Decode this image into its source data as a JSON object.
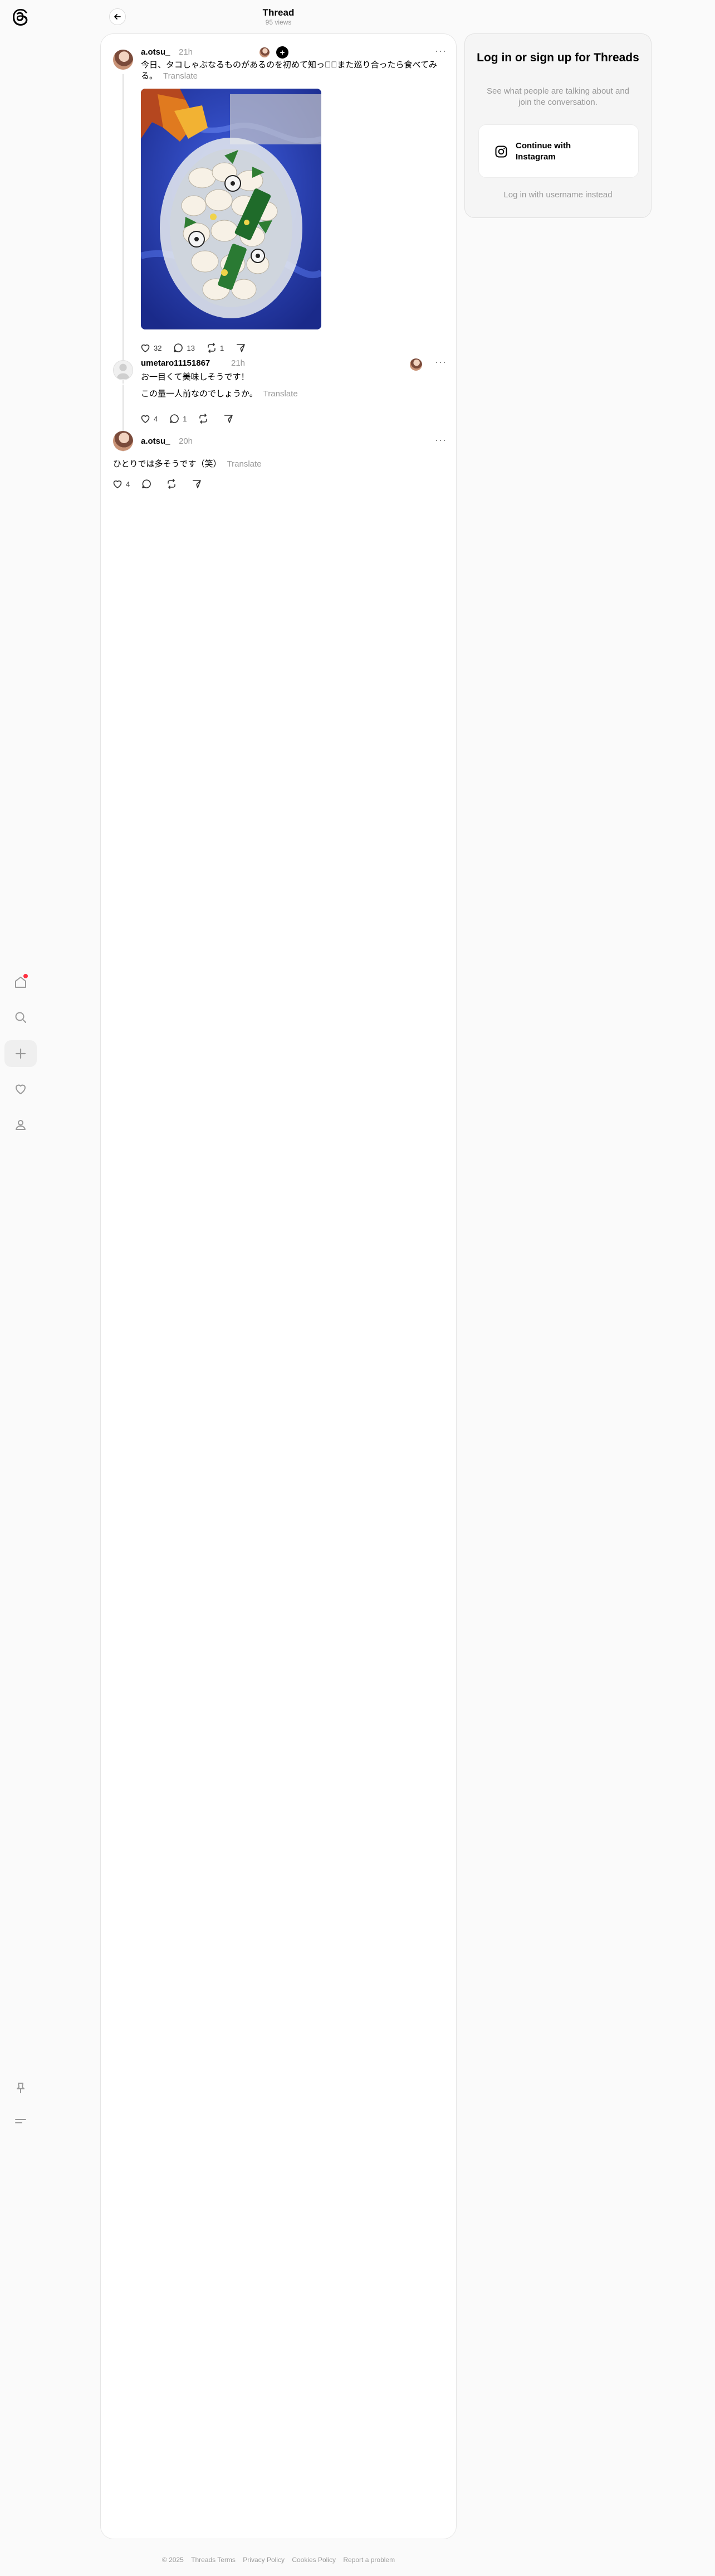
{
  "header": {
    "title": "Thread",
    "subtitle": "95 views"
  },
  "posts": [
    {
      "username": "a.otsu_",
      "time": "21h",
      "text": "今日、タコしゃぶなるものがあるのを初めて知った⃣また巡り合ったら食べてみる。",
      "translate": "Translate",
      "likes": "32",
      "replies": "13",
      "reposts": "1"
    },
    {
      "username": "umetaro11151867",
      "time": "21h",
      "line1": "お一目くて美味しそうです！",
      "line2": "この量一人前なのでしょうか。",
      "translate": "Translate",
      "likes": "4",
      "replies": "1"
    },
    {
      "username": "a.otsu_",
      "time": "20h",
      "text": "ひとりでは多そうです（笑）",
      "translate": "Translate",
      "likes": "4"
    }
  ],
  "login": {
    "title": "Log in or sign up for Threads",
    "subtitle": "See what people are talking about and join the conversation.",
    "instagram_button": "Continue with Instagram",
    "alt_link": "Log in with username instead"
  },
  "footer": [
    "© 2025",
    "Threads Terms",
    "Privacy Policy",
    "Cookies Policy",
    "Report a problem"
  ],
  "colors": {
    "accent_dot": "#ff3040",
    "photo_background": "#2540b8"
  },
  "icons": [
    "threads-logo-icon",
    "home-icon",
    "search-icon",
    "plus-icon",
    "heart-icon",
    "profile-icon",
    "pin-icon",
    "menu-icon",
    "back-arrow-icon",
    "comment-icon",
    "repost-icon",
    "share-icon",
    "instagram-icon"
  ]
}
